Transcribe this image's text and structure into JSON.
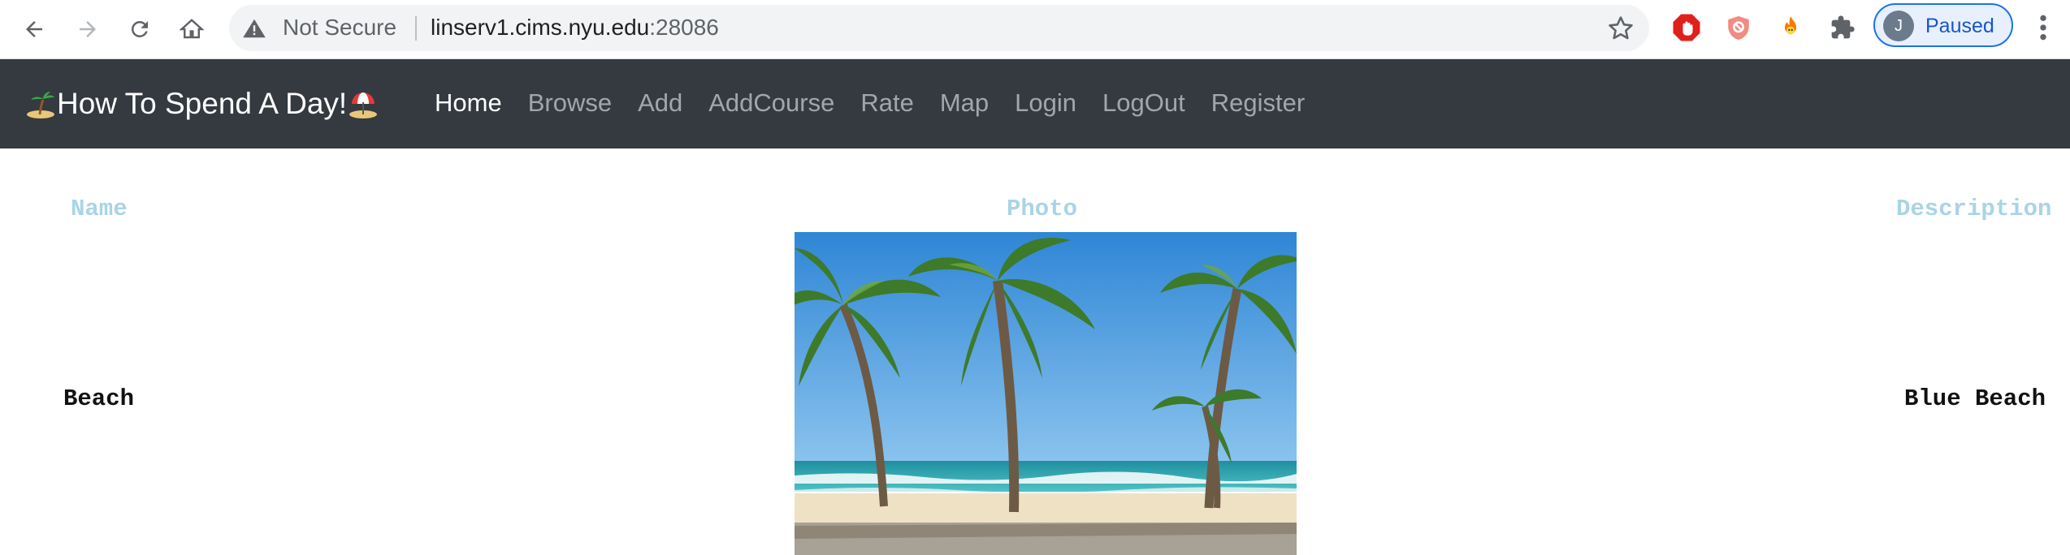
{
  "browser": {
    "security_label": "Not Secure",
    "url_host": "linserv1.cims.nyu.edu",
    "url_port": ":28086",
    "profile_initial": "J",
    "profile_status": "Paused"
  },
  "navbar": {
    "brand": "How To Spend A Day!",
    "links": [
      "Home",
      "Browse",
      "Add",
      "AddCourse",
      "Rate",
      "Map",
      "Login",
      "LogOut",
      "Register"
    ],
    "active_link": "Home"
  },
  "table": {
    "headers": {
      "name": "Name",
      "photo": "Photo",
      "description": "Description"
    },
    "rows": [
      {
        "name": "Beach",
        "photo": "beach palm trees photo",
        "description": "Blue Beach"
      }
    ]
  },
  "colors": {
    "navbar_bg": "#343a40",
    "header_text": "#a9d4e6",
    "profile_accent": "#1a73e8"
  }
}
